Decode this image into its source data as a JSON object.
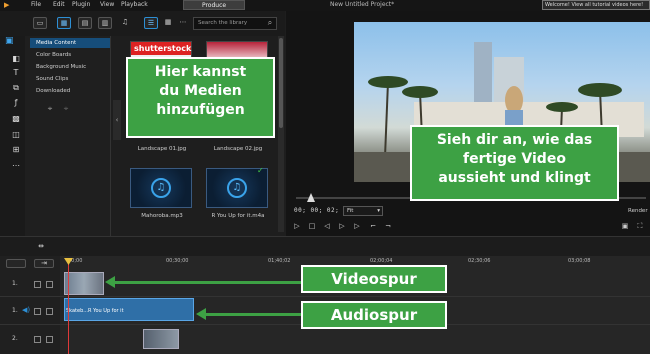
{
  "titlebar": {
    "menu": [
      "File",
      "Edit",
      "Plugin",
      "View",
      "Playback"
    ],
    "produce_label": "Produce",
    "project_title": "New Untitled Project*",
    "welcome": "Welcome! View all tutorial videos here!"
  },
  "library": {
    "search_placeholder": "Search the library",
    "categories": [
      "Media Content",
      "Color Boards",
      "Background Music",
      "Sound Clips",
      "Downloaded"
    ],
    "items": [
      {
        "label": "",
        "kind": "image",
        "brand": "shutterstock"
      },
      {
        "label": "",
        "kind": "image"
      },
      {
        "label": "Landscape 01.jpg",
        "kind": "image"
      },
      {
        "label": "Landscape 02.jpg",
        "kind": "image"
      },
      {
        "label": "Mahoroba.mp3",
        "kind": "audio"
      },
      {
        "label": "R You Up for it.m4a",
        "kind": "audio"
      }
    ]
  },
  "preview": {
    "timecode": "00; 00; 02; 06",
    "fit": "Fit",
    "render_label": "Render"
  },
  "timeline": {
    "ruler": [
      "00;00",
      "00;30;00",
      "01;40;02",
      "02;00;04",
      "02;30;06",
      "03;00;08"
    ],
    "tracks": [
      {
        "label": "1."
      },
      {
        "label": "1."
      },
      {
        "label": "2."
      }
    ],
    "audio_clip_text": "Skateb...R You Up for it"
  },
  "annotations": {
    "media": [
      "Hier kannst",
      "du Medien",
      "hinzufügen"
    ],
    "preview": [
      "Sieh dir an, wie das",
      "fertige Video",
      "aussieht und klingt"
    ],
    "video_track": "Videospur",
    "audio_track": "Audiospur",
    "color": "#3da144"
  }
}
